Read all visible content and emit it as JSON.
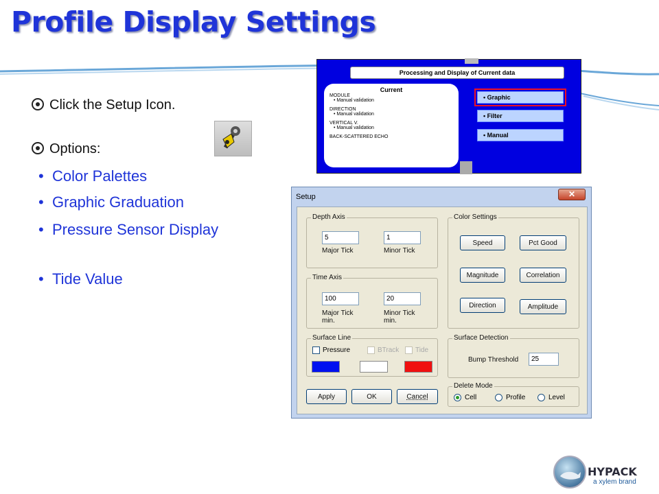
{
  "slide": {
    "title": "Profile Display Settings",
    "bullets": [
      {
        "text": "Click the Setup Icon."
      },
      {
        "text": "Options:"
      }
    ],
    "options": [
      "Color Palettes",
      "Graphic Graduation",
      "Pressure Sensor Display",
      "Tide Value"
    ]
  },
  "processing_window": {
    "header": "Processing and Display of Current data",
    "current_title": "Current",
    "sections": [
      {
        "heading": "MODULE",
        "value": "• Manual validation"
      },
      {
        "heading": "DIRECTION",
        "value": "• Manual validation"
      },
      {
        "heading": "VERTICAL V.",
        "value": "• Manual validation"
      },
      {
        "heading": "BACK-SCATTERED ECHO",
        "value": ""
      }
    ],
    "options": [
      "• Graphic",
      "• Filter",
      "• Manual"
    ],
    "colors": {
      "background": "#0000e0",
      "option_fill": "#bcd4ff",
      "selection": "#ee1122"
    }
  },
  "setup_dialog": {
    "title": "Setup",
    "close_label": "✕",
    "depth_axis": {
      "label": "Depth Axis",
      "major_value": "5",
      "minor_value": "1",
      "major_label": "Major Tick",
      "minor_label": "Minor Tick"
    },
    "time_axis": {
      "label": "Time Axis",
      "major_value": "100",
      "minor_value": "20",
      "major_label": "Major Tick",
      "minor_label": "Minor Tick",
      "major_unit": "min.",
      "minor_unit": "min."
    },
    "color_settings": {
      "label": "Color Settings",
      "buttons": [
        "Speed",
        "Pct Good",
        "Magnitude",
        "Correlation",
        "Direction",
        "Amplitude"
      ]
    },
    "surface_line": {
      "label": "Surface Line",
      "checks": [
        "Pressure",
        "BTrack",
        "Tide"
      ],
      "swatch_colors": [
        "#0010f0",
        "#ffffff",
        "#f01010"
      ]
    },
    "surface_detection": {
      "label": "Surface Detection",
      "bump_label": "Bump Threshold",
      "bump_value": "25"
    },
    "delete_mode": {
      "label": "Delete Mode",
      "options": [
        "Cell",
        "Profile",
        "Level"
      ],
      "selected": "Cell"
    },
    "buttons": {
      "apply": "Apply",
      "ok": "OK",
      "cancel": "Cancel"
    }
  },
  "logo": {
    "name": "HYPACK",
    "tagline": "a xylem brand"
  },
  "colors": {
    "title": "#1f34d8",
    "accent_line": "#4a8bc6",
    "dialog_frame": "#c2d3ee"
  }
}
